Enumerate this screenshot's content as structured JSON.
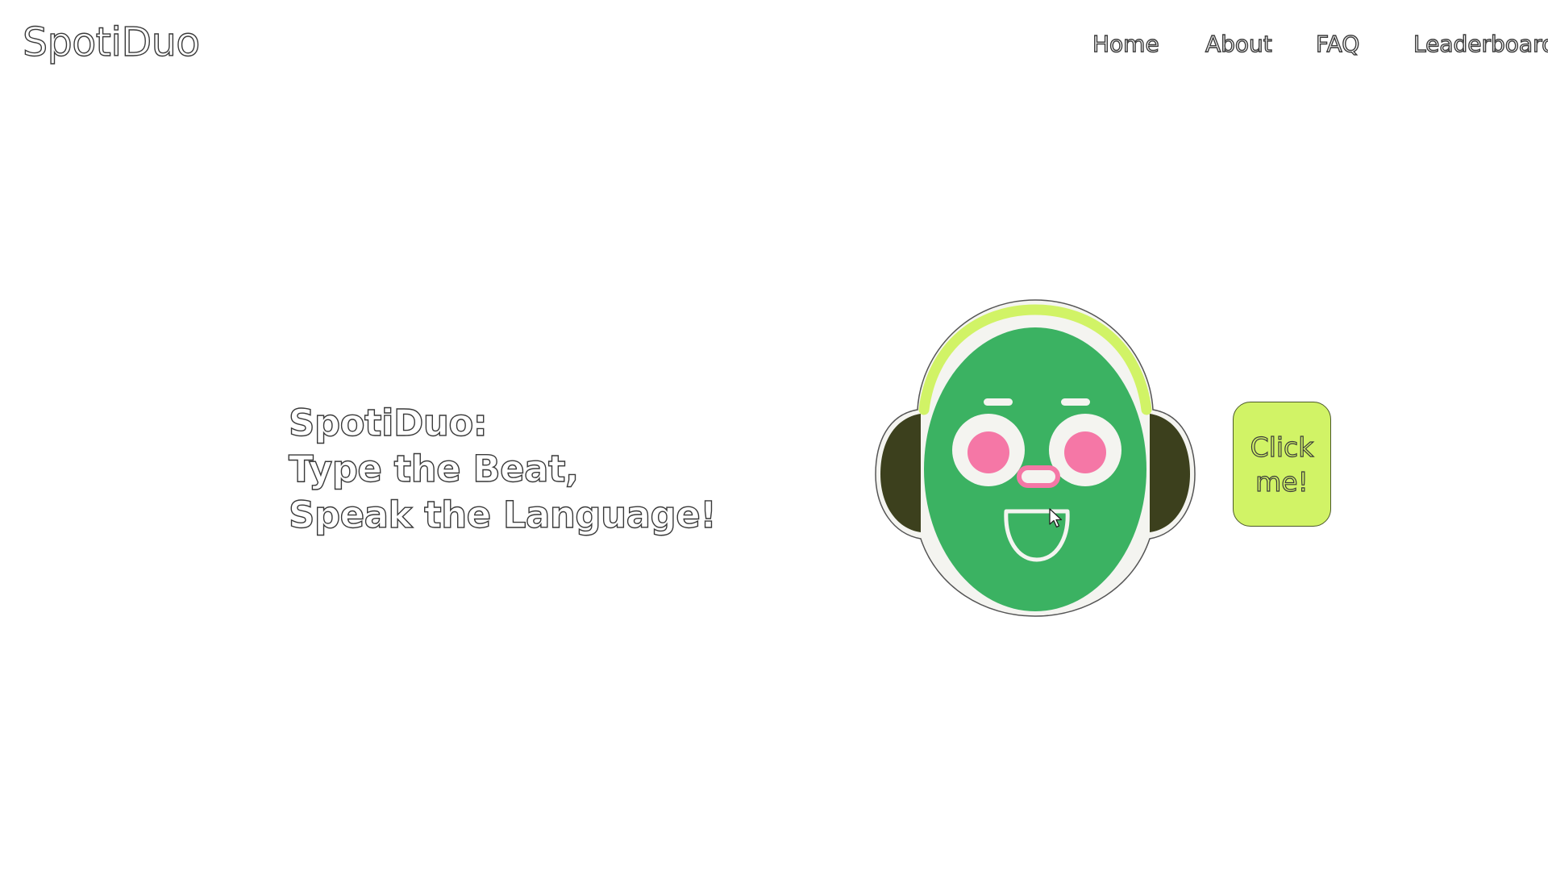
{
  "header": {
    "logo": "SpotiDuo",
    "nav": {
      "home": "Home",
      "about": "About",
      "faq": "FAQ",
      "leaderboard": "Leaderboard"
    }
  },
  "hero": {
    "line1": "SpotiDuo:",
    "line2": "Type the Beat,",
    "line3": "Speak the Language!"
  },
  "cta": {
    "line1": "Click",
    "line2": "me!"
  },
  "colors": {
    "face": "#3bb262",
    "headband": "#d1f366",
    "earcups": "#3c401d",
    "cheeks": "#f577a6",
    "button": "#d1f366"
  },
  "icons": {
    "mascot": "headphone-robot-mascot-icon",
    "cursor": "mouse-pointer-icon"
  }
}
